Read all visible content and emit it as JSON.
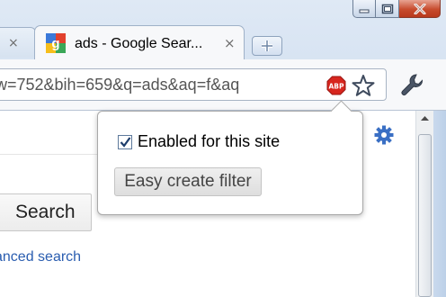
{
  "window": {
    "controls": {
      "minimize": "minimize-icon",
      "maximize": "maximize-icon",
      "close": "close-icon"
    },
    "close_color": "#c74b2d"
  },
  "tabs": [
    {
      "label": "",
      "close_glyph": "×",
      "active": false
    },
    {
      "label": "ads - Google Sear...",
      "close_glyph": "×",
      "active": true,
      "favicon": "google-favicon"
    }
  ],
  "new_tab_icon": "plus-icon",
  "omnibox": {
    "url": "w=752&bih=659&q=ads&aq=f&aq",
    "extension_icon": "abp-icon",
    "extension_text": "ABP",
    "bookmark_icon": "star-icon"
  },
  "wrench_icon": "wrench-icon",
  "page": {
    "search_button": "Search",
    "advanced_search_link": "anced search",
    "settings_icon": "gear-icon",
    "link_color": "#2a5db0"
  },
  "popup": {
    "checkbox_label": "Enabled for this site",
    "checkbox_checked": true,
    "create_filter_button": "Easy create filter"
  },
  "colors": {
    "frame": "#c9d9ed",
    "abp_red": "#d7261e",
    "gear_blue": "#3a6fc4"
  }
}
